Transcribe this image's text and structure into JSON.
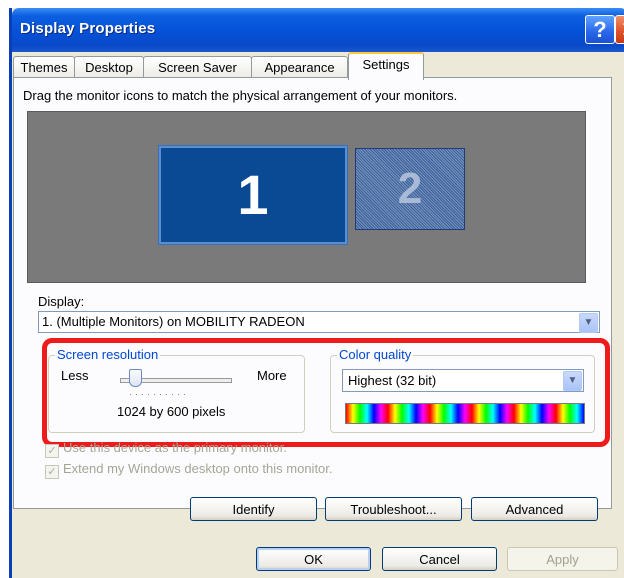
{
  "window": {
    "title": "Display Properties",
    "help_label": "?",
    "close_label": "✕"
  },
  "tabs": [
    {
      "label": "Themes"
    },
    {
      "label": "Desktop"
    },
    {
      "label": "Screen Saver"
    },
    {
      "label": "Appearance"
    },
    {
      "label": "Settings"
    }
  ],
  "active_tab": "Settings",
  "settings": {
    "instruction": "Drag the monitor icons to match the physical arrangement of your monitors.",
    "monitors": [
      {
        "label": "1"
      },
      {
        "label": "2"
      }
    ],
    "display_label": "Display:",
    "display_value": "1. (Multiple Monitors) on MOBILITY RADEON",
    "resolution": {
      "title": "Screen resolution",
      "less_label": "Less",
      "more_label": "More",
      "value_text": "1024 by 600 pixels",
      "slider_fraction": 0.1
    },
    "color_quality": {
      "title": "Color quality",
      "value": "Highest (32 bit)"
    },
    "checkboxes": [
      {
        "label": "Use this device as the primary monitor.",
        "checked": true
      },
      {
        "label": "Extend my Windows desktop onto this monitor.",
        "checked": true
      }
    ]
  },
  "buttons": {
    "identify": "Identify",
    "troubleshoot": "Troubleshoot...",
    "advanced": "Advanced",
    "ok": "OK",
    "cancel": "Cancel",
    "apply": "Apply"
  },
  "icons": {
    "dropdown": "chevron-down-icon",
    "check": "✓"
  },
  "colors": {
    "titlebar": "#0551d8",
    "highlight": "#ef1b1b",
    "group_title": "#0046d5",
    "face": "#ece9d8"
  }
}
